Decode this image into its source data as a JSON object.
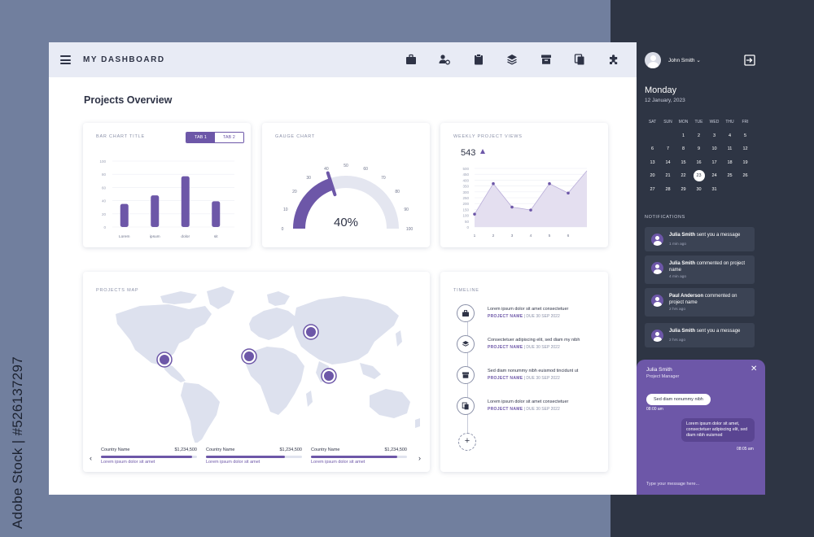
{
  "watermark": "Adobe Stock | #526137297",
  "header": {
    "title": "MY DASHBOARD"
  },
  "page_title": "Projects Overview",
  "bar_card": {
    "title": "BAR CHART TITLE",
    "tabs": [
      "TAB 1",
      "TAB 2"
    ]
  },
  "gauge_card": {
    "title": "GAUGE CHART",
    "value_label": "40%",
    "value": 40,
    "ticks": [
      "0",
      "10",
      "20",
      "30",
      "40",
      "50",
      "60",
      "70",
      "80",
      "90",
      "100"
    ]
  },
  "views_card": {
    "title": "WEEKLY PROJECT VIEWS",
    "total": "543",
    "trend": "up"
  },
  "map_card": {
    "title": "PROJECTS MAP",
    "countries": [
      {
        "name": "Country Name",
        "value": "$1,234,500",
        "sub": "Lorem ipsum dolor sit amet",
        "progress": 0.95
      },
      {
        "name": "Country Name",
        "value": "$1,234,500",
        "sub": "Lorem ipsum dolor sit amet",
        "progress": 0.82
      },
      {
        "name": "Country Name",
        "value": "$1,234,500",
        "sub": "Lorem ipsum dolor sit amet",
        "progress": 0.9
      }
    ],
    "prev": "‹",
    "next": "›"
  },
  "timeline": {
    "title": "TIMELINE",
    "items": [
      {
        "text": "Lorem ipsum dolor sit amet consectetuer",
        "project": "PROJECT NAME",
        "due": "| DUE 30 SEP 2022",
        "icon": "briefcase-icon"
      },
      {
        "text": "Consectetuer adipiscing elit, sed diam my nibh",
        "project": "PROJECT NAME",
        "due": "| DUE 30 SEP 2022",
        "icon": "layers-icon"
      },
      {
        "text": "Sed diam nonummy nibh euismod tincidunt ut",
        "project": "PROJECT NAME",
        "due": "| DUE 30 SEP 2022",
        "icon": "archive-icon"
      },
      {
        "text": "Lorem ipsum dolor sit amet consectetuer",
        "project": "PROJECT NAME",
        "due": "| DUE 30 SEP 2022",
        "icon": "copy-icon"
      }
    ],
    "add": "+"
  },
  "sidebar": {
    "user": "John Smith",
    "user_caret": "⌄",
    "day": "Monday",
    "date": "12 January, 2023",
    "calendar": {
      "headers": [
        "SAT",
        "SUN",
        "MON",
        "TUE",
        "WED",
        "THU",
        "FRI"
      ],
      "rows": [
        [
          "",
          "",
          "1",
          "2",
          "3",
          "4",
          "5"
        ],
        [
          "6",
          "7",
          "8",
          "9",
          "10",
          "11",
          "12"
        ],
        [
          "13",
          "14",
          "15",
          "16",
          "17",
          "18",
          "19"
        ],
        [
          "20",
          "21",
          "22",
          "23",
          "24",
          "25",
          "26"
        ],
        [
          "27",
          "28",
          "29",
          "30",
          "31",
          "",
          ""
        ]
      ],
      "selected": "23"
    },
    "notifications_title": "NOTIFICATIONS",
    "notifications": [
      {
        "name": "Julia Smith",
        "text": "sent you a message",
        "time": "1 min ago"
      },
      {
        "name": "Julia Smith",
        "text": "commented on project name",
        "time": "4 min ago"
      },
      {
        "name": "Paul Anderson",
        "text": "commented on project name",
        "time": "2 hrs ago"
      },
      {
        "name": "Julia Smith",
        "text": "sent you a message",
        "time": "2 hrs ago"
      }
    ]
  },
  "chat": {
    "name": "Julia Smith",
    "role": "Project Manager",
    "close": "✕",
    "incoming": "Sed diam nonummy nibh",
    "incoming_time": "08:00 am",
    "outgoing": "Lorem ipsum dolor sit amet, consectetuer adipiscing elit, sed diam nibh euismod",
    "outgoing_time": "08:05 am",
    "placeholder": "Type your message here..."
  },
  "colors": {
    "accent": "#6d57a8",
    "sidebar": "#2e3544",
    "area": "#e4dff0",
    "map": "#dde1ee"
  },
  "chart_data": [
    {
      "type": "bar",
      "title": "BAR CHART TITLE",
      "categories": [
        "Lorem",
        "ipsum",
        "dolor",
        "sit"
      ],
      "values": [
        35,
        48,
        77,
        39
      ],
      "ylim": [
        0,
        100
      ],
      "yticks": [
        "0",
        "20",
        "40",
        "60",
        "80",
        "100"
      ],
      "grid": true
    },
    {
      "type": "area",
      "title": "WEEKLY PROJECT VIEWS",
      "x": [
        "1",
        "2",
        "3",
        "4",
        "5",
        "6"
      ],
      "values": [
        110,
        370,
        170,
        145,
        370,
        290,
        480
      ],
      "ylim": [
        0,
        500
      ],
      "yticks": [
        "0",
        "50",
        "100",
        "150",
        "200",
        "250",
        "300",
        "350",
        "400",
        "450",
        "500"
      ],
      "grid": true
    }
  ]
}
